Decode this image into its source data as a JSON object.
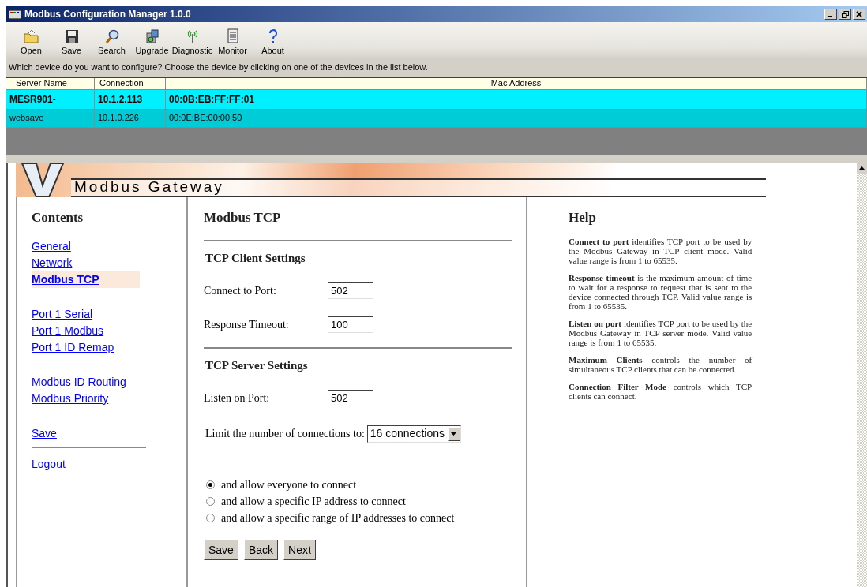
{
  "window": {
    "title": "Modbus Configuration Manager 1.0.0"
  },
  "toolbar": [
    {
      "label": "Open",
      "kind": "open"
    },
    {
      "label": "Save",
      "kind": "save"
    },
    {
      "label": "Search",
      "kind": "search"
    },
    {
      "label": "Upgrade",
      "kind": "upgrade"
    },
    {
      "label": "Diagnostic",
      "kind": "diagnostic"
    },
    {
      "label": "Monitor",
      "kind": "monitor"
    },
    {
      "label": "About",
      "kind": "about"
    }
  ],
  "prompt": "Which device do you want to configure? Choose the device by clicking on one of the devices in the list below.",
  "device_table": {
    "columns": [
      "Server Name",
      "Connection",
      "Mac Address"
    ],
    "rows": [
      {
        "cells": [
          "MESR901-",
          "10.1.2.113",
          "00:0B:EB:FF:FF:01"
        ],
        "selected": true
      },
      {
        "cells": [
          "websave",
          "10.1.0.226",
          "00:0E:BE:00:00:50"
        ],
        "selected": false
      }
    ]
  },
  "banner": {
    "subtitle": "Modbus Gateway"
  },
  "contents": {
    "title": "Contents",
    "groups": [
      {
        "divider_before": false,
        "links": [
          {
            "label": "General",
            "selected": false
          },
          {
            "label": "Network",
            "selected": false
          },
          {
            "label": "Modbus TCP",
            "selected": true
          }
        ]
      },
      {
        "divider_before": false,
        "links": [
          {
            "label": "Port 1 Serial",
            "selected": false
          },
          {
            "label": "Port 1 Modbus",
            "selected": false
          },
          {
            "label": "Port 1 ID Remap",
            "selected": false
          }
        ]
      },
      {
        "divider_before": false,
        "links": [
          {
            "label": "Modbus ID Routing",
            "selected": false
          },
          {
            "label": "Modbus Priority",
            "selected": false
          }
        ]
      },
      {
        "divider_before": false,
        "links": [
          {
            "label": "Save",
            "selected": false
          }
        ]
      },
      {
        "divider_before": true,
        "links": [
          {
            "label": "Logout",
            "selected": false
          }
        ]
      }
    ]
  },
  "main": {
    "title": "Modbus TCP",
    "sections": [
      {
        "title": "TCP Client Settings",
        "fields": [
          {
            "label": "Connect to Port:",
            "value": "502"
          },
          {
            "label": "Response Timeout:",
            "value": "100"
          }
        ]
      },
      {
        "title": "TCP Server Settings",
        "fields": [
          {
            "label": "Listen on Port:",
            "value": "502"
          }
        ],
        "limit": {
          "label": "Limit the number of connections to:",
          "value": "16 connections"
        },
        "radios": [
          {
            "label": "and allow everyone to connect",
            "selected": true
          },
          {
            "label": "and allow a specific IP address to connect",
            "selected": false
          },
          {
            "label": "and allow a specific range of IP addresses to connect",
            "selected": false
          }
        ]
      }
    ],
    "buttons": [
      "Save",
      "Back",
      "Next"
    ]
  },
  "help": {
    "title": "Help",
    "paragraphs": [
      "**Connect to port** identifies TCP port to be used by the Modbus Gateway in TCP client mode. Valid value range is from 1 to 65535.",
      "**Response timeout** is the maximum amount of time to wait for a response to request that is sent to the device connected through TCP. Valid value range is from 1 to 65535.",
      "**Listen on port** identifies TCP port to be used by the Modbus Gateway in TCP server mode. Valid value range is from 1 to 65535.",
      "**Maximum Clients** controls the number of simultaneous TCP clients that can be connected.",
      "**Connection Filter Mode** controls which TCP clients can connect."
    ]
  }
}
